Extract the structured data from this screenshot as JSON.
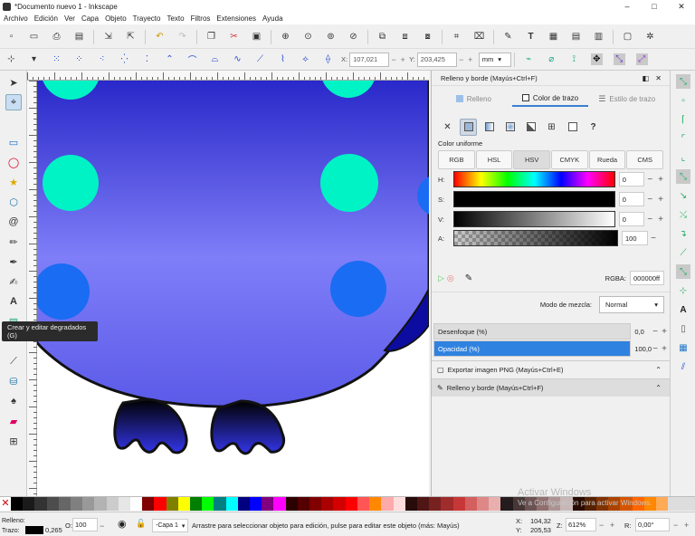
{
  "window": {
    "title": "*Documento nuevo 1 - Inkscape",
    "minimize": "–",
    "maximize": "□",
    "close": "✕"
  },
  "menu": [
    "Archivo",
    "Edición",
    "Ver",
    "Capa",
    "Objeto",
    "Trayecto",
    "Texto",
    "Filtros",
    "Extensiones",
    "Ayuda"
  ],
  "controls": {
    "x_label": "X:",
    "x_value": "107,021",
    "y_label": "Y:",
    "y_value": "203,425",
    "unit": "mm"
  },
  "tooltip": "Crear y editar degradados (G)",
  "dock": {
    "title": "Relleno y borde (Mayús+Ctrl+F)",
    "tabs": [
      "Relleno",
      "Color de trazo",
      "Estilo de trazo"
    ],
    "active_tab": 1,
    "flat_label": "Color uniforme",
    "models": [
      "RGB",
      "HSL",
      "HSV",
      "CMYK",
      "Rueda",
      "CMS"
    ],
    "active_model": 2,
    "sliders": [
      {
        "label": "H:",
        "value": "0"
      },
      {
        "label": "S:",
        "value": "0"
      },
      {
        "label": "V:",
        "value": "0"
      },
      {
        "label": "A:",
        "value": "100"
      }
    ],
    "rgba_label": "RGBA:",
    "rgba_value": "000000ff",
    "blend_label": "Modo de mezcla:",
    "blend_value": "Normal",
    "blur_label": "Desenfoque (%)",
    "blur_value": "0,0",
    "opacity_label": "Opacidad (%)",
    "opacity_value": "100,0",
    "opacity_level": 1.0,
    "collapsed": [
      "Exportar imagen PNG (Mayús+Ctrl+E)",
      "Relleno y borde (Mayús+Ctrl+F)"
    ]
  },
  "status": {
    "fill_label": "Relleno:",
    "stroke_label": "Trazo:",
    "stroke_width": "0,265",
    "opacity_label": "O:",
    "opacity_value": "100",
    "layer": "-Capa 1",
    "message": "Arrastre para seleccionar objeto para edición, pulse para editar este objeto (más: Mayús)",
    "cursor_x_label": "X:",
    "cursor_x": "104,32",
    "cursor_y_label": "Y:",
    "cursor_y": "205,53",
    "zoom_label": "Z:",
    "zoom": "612%",
    "rotation_label": "R:",
    "rotation": "0,00°"
  },
  "watermark": {
    "line1": "Activar Windows",
    "line2": "Ve a Configuración para activar Windows."
  },
  "colors": {
    "accent": "#3a7fd1",
    "dot_cyan": "#00f2c3",
    "dot_blue": "#1a6cf2",
    "body_top": "#2d2fd4",
    "body_mid": "#7b7af7"
  }
}
